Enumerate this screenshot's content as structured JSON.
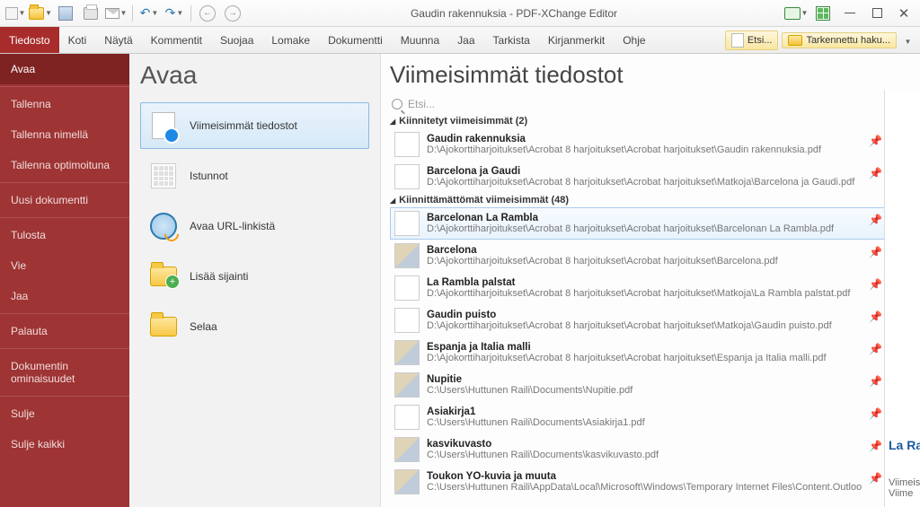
{
  "titlebar": {
    "title": "Gaudin rakennuksia - PDF-XChange Editor"
  },
  "ribbon": {
    "file": "Tiedosto",
    "tabs": [
      "Koti",
      "Näytä",
      "Kommentit",
      "Suojaa",
      "Lomake",
      "Dokumentti",
      "Muunna",
      "Jaa",
      "Tarkista",
      "Kirjanmerkit",
      "Ohje"
    ],
    "tools": {
      "search": "Etsi...",
      "advanced": "Tarkennettu haku..."
    }
  },
  "sidebar": {
    "items": [
      "Avaa",
      "Tallenna",
      "Tallenna nimellä",
      "Tallenna optimoituna",
      "Uusi dokumentti",
      "Tulosta",
      "Vie",
      "Jaa",
      "Palauta",
      "Dokumentin ominaisuudet",
      "Sulje",
      "Sulje kaikki"
    ]
  },
  "options": {
    "heading": "Avaa",
    "items": [
      "Viimeisimmät tiedostot",
      "Istunnot",
      "Avaa URL-linkistä",
      "Lisää sijainti",
      "Selaa"
    ]
  },
  "recent": {
    "heading": "Viimeisimmät tiedostot",
    "search_placeholder": "Etsi...",
    "group_pinned": "Kiinnitetyt viimeisimmät (2)",
    "group_unpinned": "Kiinnittämättömät viimeisimmät (48)",
    "pinned": [
      {
        "name": "Gaudin rakennuksia",
        "path": "D:\\Ajokorttiharjoitukset\\Acrobat 8 harjoitukset\\Acrobat harjoitukset\\Gaudin rakennuksia.pdf"
      },
      {
        "name": "Barcelona ja Gaudi",
        "path": "D:\\Ajokorttiharjoitukset\\Acrobat 8 harjoitukset\\Acrobat harjoitukset\\Matkoja\\Barcelona ja Gaudi.pdf"
      }
    ],
    "files": [
      {
        "name": "Barcelonan La Rambla",
        "path": "D:\\Ajokorttiharjoitukset\\Acrobat 8 harjoitukset\\Acrobat harjoitukset\\Barcelonan La Rambla.pdf",
        "img": false
      },
      {
        "name": "Barcelona",
        "path": "D:\\Ajokorttiharjoitukset\\Acrobat 8 harjoitukset\\Acrobat harjoitukset\\Barcelona.pdf",
        "img": true
      },
      {
        "name": "La Rambla palstat",
        "path": "D:\\Ajokorttiharjoitukset\\Acrobat 8 harjoitukset\\Acrobat harjoitukset\\Matkoja\\La Rambla palstat.pdf",
        "img": false
      },
      {
        "name": "Gaudin puisto",
        "path": "D:\\Ajokorttiharjoitukset\\Acrobat 8 harjoitukset\\Acrobat harjoitukset\\Matkoja\\Gaudin puisto.pdf",
        "img": false
      },
      {
        "name": "Espanja ja Italia malli",
        "path": "D:\\Ajokorttiharjoitukset\\Acrobat 8 harjoitukset\\Acrobat harjoitukset\\Espanja ja Italia malli.pdf",
        "img": true
      },
      {
        "name": "Nupitie",
        "path": "C:\\Users\\Huttunen Raili\\Documents\\Nupitie.pdf",
        "img": true
      },
      {
        "name": "Asiakirja1",
        "path": "C:\\Users\\Huttunen Raili\\Documents\\Asiakirja1.pdf",
        "img": false
      },
      {
        "name": "kasvikuvasto",
        "path": "C:\\Users\\Huttunen Raili\\Documents\\kasvikuvasto.pdf",
        "img": true
      },
      {
        "name": "Toukon YO-kuvia ja muuta",
        "path": "C:\\Users\\Huttunen Raili\\AppData\\Local\\Microsoft\\Windows\\Temporary Internet Files\\Content.Outloo",
        "img": true
      }
    ]
  },
  "preview": {
    "title": "La Ra",
    "l1": "Viimeis",
    "l2": "Viime"
  }
}
